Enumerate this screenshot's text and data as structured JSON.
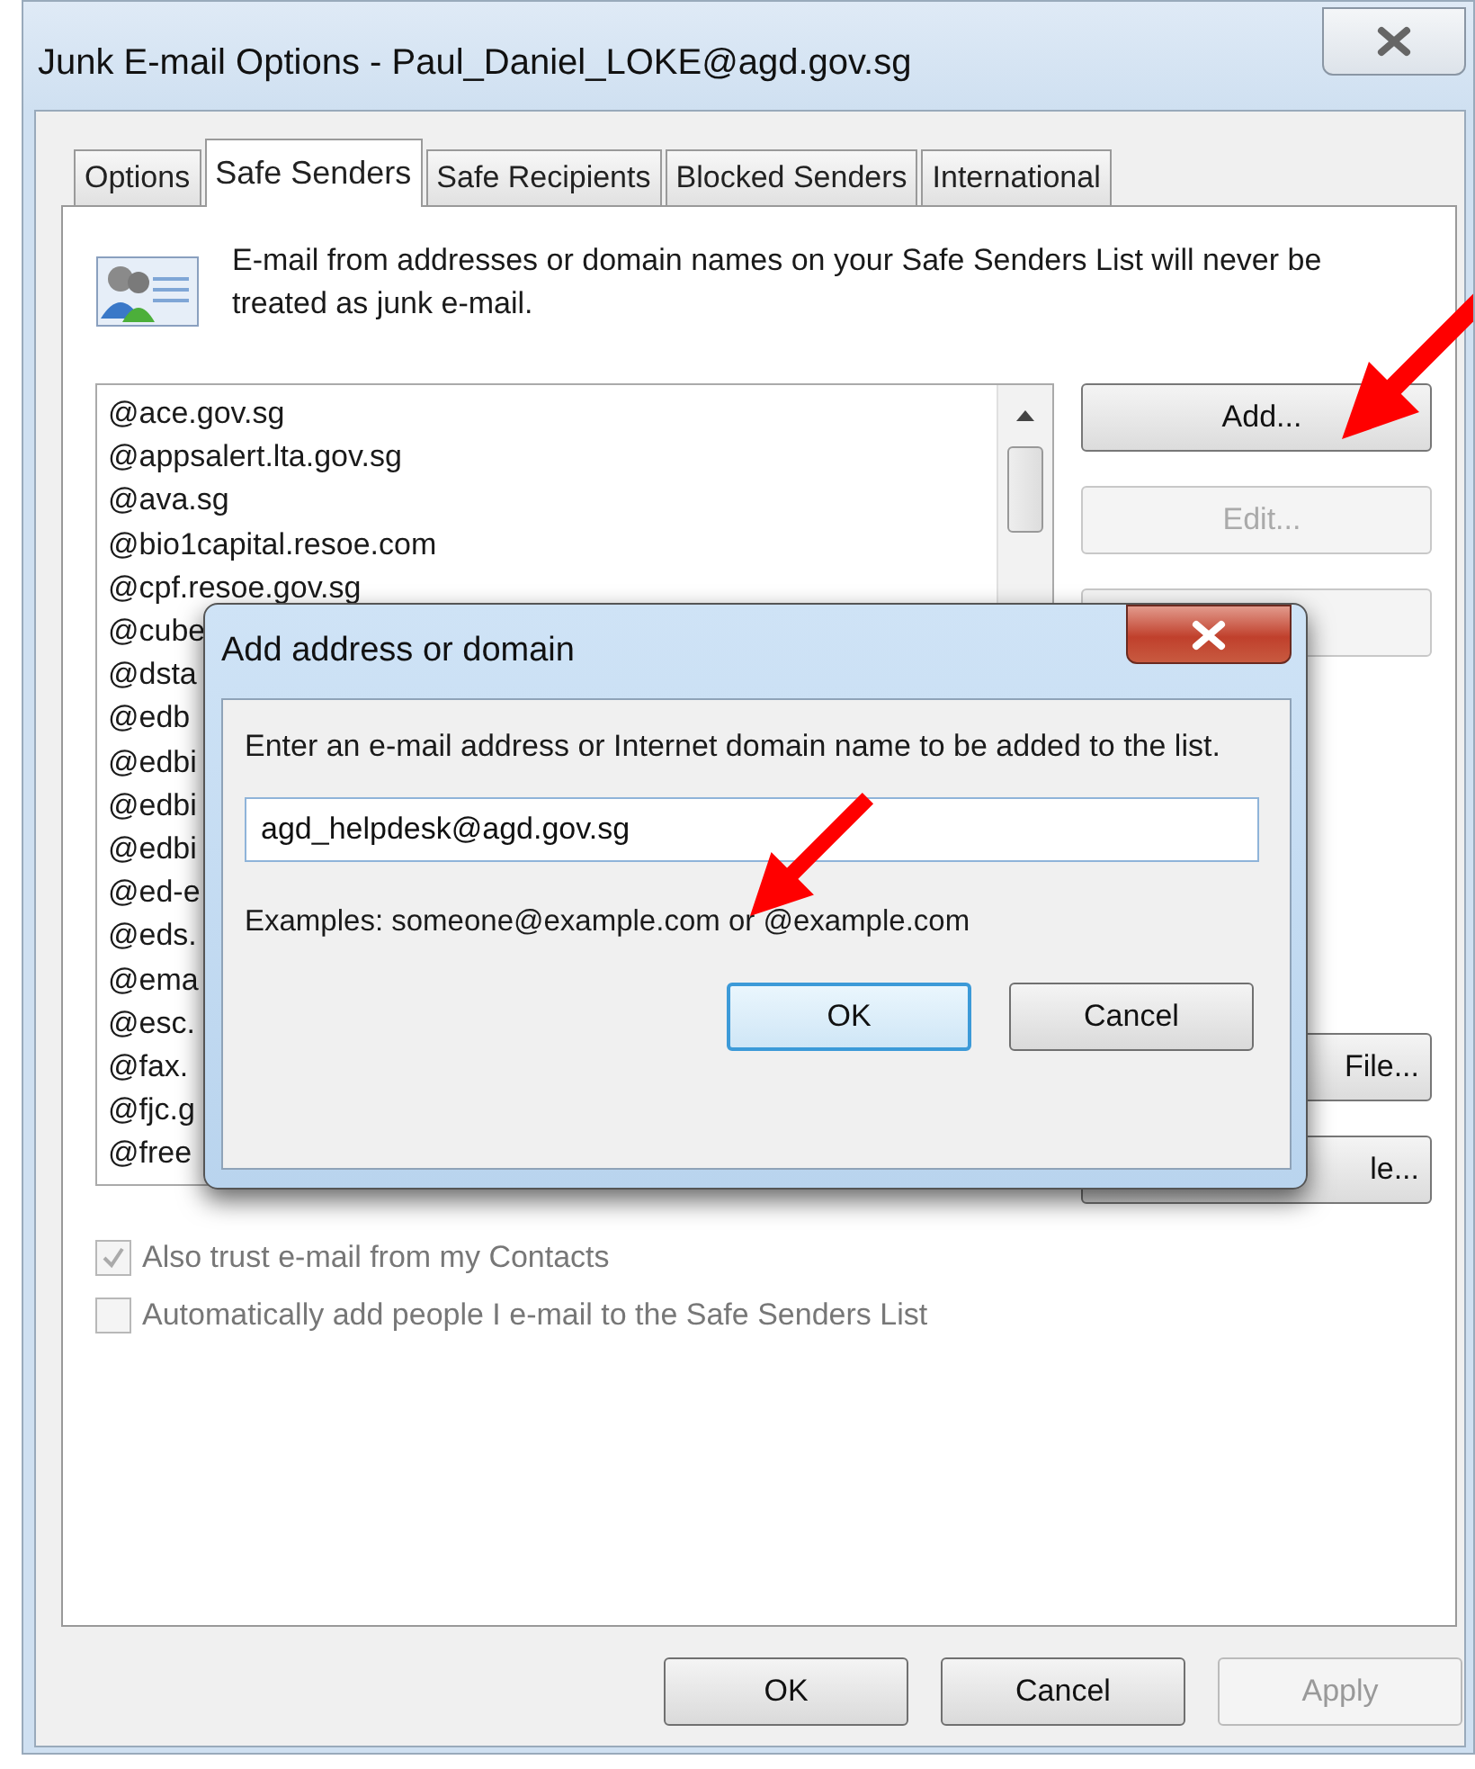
{
  "window": {
    "title": "Junk E-mail Options - Paul_Daniel_LOKE@agd.gov.sg"
  },
  "tabs": [
    {
      "label": "Options",
      "selected": false
    },
    {
      "label": "Safe Senders",
      "selected": true
    },
    {
      "label": "Safe Recipients",
      "selected": false
    },
    {
      "label": "Blocked Senders",
      "selected": false
    },
    {
      "label": "International",
      "selected": false
    }
  ],
  "description": "E-mail from addresses or domain names on your Safe Senders List will never be treated as junk e-mail.",
  "safe_senders": [
    "@ace.gov.sg",
    "@appsalert.lta.gov.sg",
    "@ava.sg",
    "@bio1capital.resoe.com",
    "@cpf.resoe.gov.sg",
    "@cube",
    "@dsta",
    "@edb",
    "@edbi",
    "@edbi",
    "@edbi",
    "@ed-e",
    "@eds.",
    "@ema",
    "@esc.",
    "@fax.",
    "@fjc.g",
    "@free"
  ],
  "side_buttons": [
    {
      "label": "Add...",
      "disabled": false
    },
    {
      "label": "Edit...",
      "disabled": true
    },
    {
      "disabled": true
    },
    {
      "label": "File...",
      "disabled": false
    },
    {
      "label": "le...",
      "disabled": false
    }
  ],
  "options": [
    {
      "label": "Also trust e-mail from my Contacts",
      "checked": true,
      "disabled": true
    },
    {
      "label": "Automatically add people I e-mail to the Safe Senders List",
      "checked": false,
      "disabled": true
    }
  ],
  "buttons": [
    {
      "label": "OK",
      "disabled": false
    },
    {
      "label": "Cancel",
      "disabled": false
    },
    {
      "label": "Apply",
      "disabled": true
    }
  ],
  "dialog": {
    "title": "Add address or domain",
    "prompt": "Enter an e-mail address or Internet domain name to be added to the list.",
    "value": "agd_helpdesk@agd.gov.sg",
    "examples": "Examples: someone@example.com or @example.com",
    "buttons": [
      {
        "label": "OK",
        "default": true
      },
      {
        "label": "Cancel",
        "default": false
      }
    ]
  }
}
